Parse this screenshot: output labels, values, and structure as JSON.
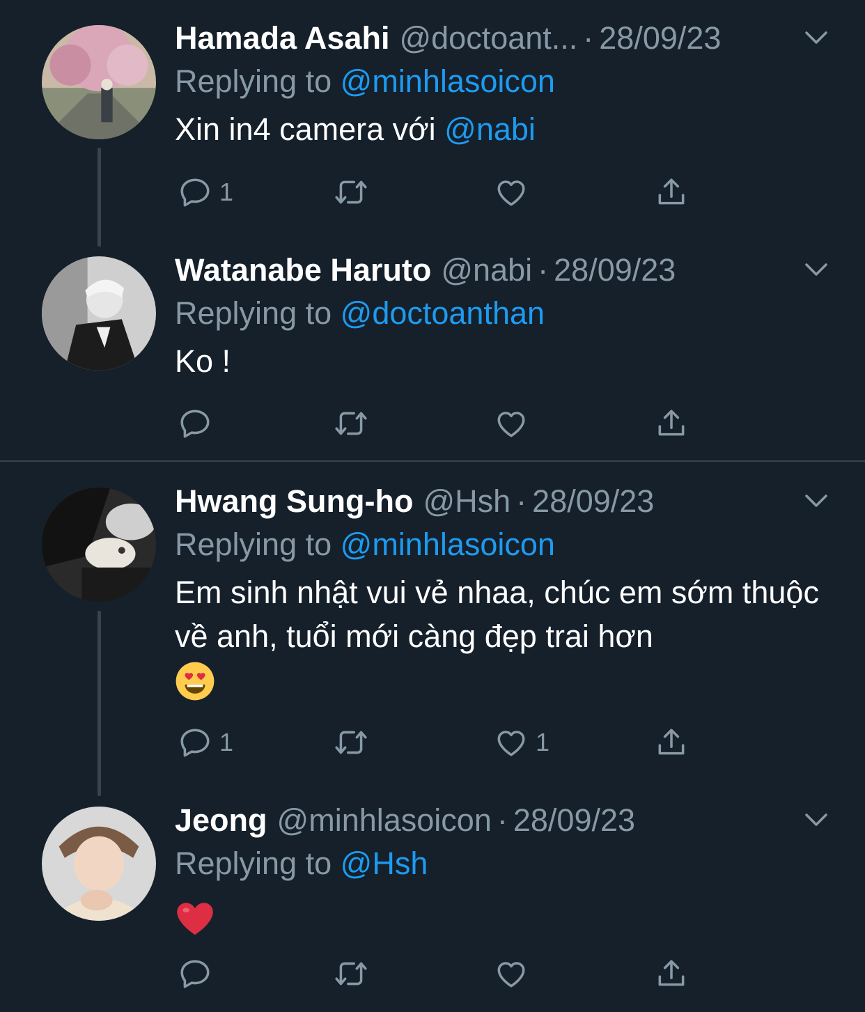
{
  "tweets": [
    {
      "name": "Hamada Asahi",
      "handle": "@doctoant...",
      "sep": "·",
      "date": "28/09/23",
      "replying_prefix": "Replying to ",
      "replying_to": "@minhlasoicon",
      "text": "Xin in4 camera với ",
      "text_mention": "@nabi",
      "reply_count": "1",
      "retweet_count": "",
      "like_count": ""
    },
    {
      "name": "Watanabe Haruto",
      "handle": "@nabi",
      "sep": "·",
      "date": "28/09/23",
      "replying_prefix": "Replying to ",
      "replying_to": "@doctoanthan",
      "text": "Ko !",
      "text_mention": "",
      "reply_count": "",
      "retweet_count": "",
      "like_count": ""
    },
    {
      "name": "Hwang Sung-ho",
      "handle": "@Hsh",
      "sep": "·",
      "date": "28/09/23",
      "replying_prefix": "Replying to ",
      "replying_to": "@minhlasoicon",
      "text": "Em sinh nhật vui vẻ nhaa, chúc em sớm thuộc về anh, tuổi mới càng đẹp trai hơn",
      "text_emoji": "😍",
      "text_mention": "",
      "reply_count": "1",
      "retweet_count": "",
      "like_count": "1"
    },
    {
      "name": "Jeong",
      "handle": "@minhlasoicon",
      "sep": "·",
      "date": "28/09/23",
      "replying_prefix": "Replying to ",
      "replying_to": "@Hsh",
      "text": "",
      "text_emoji": "❤️",
      "text_mention": "",
      "reply_count": "",
      "retweet_count": "",
      "like_count": ""
    }
  ],
  "colors": {
    "background": "#15202b",
    "secondary_text": "#8899a6",
    "mention": "#1d9bf0",
    "divider": "#38444d"
  },
  "icons": [
    "reply-icon",
    "retweet-icon",
    "like-icon",
    "share-icon",
    "chevron-down-icon"
  ]
}
